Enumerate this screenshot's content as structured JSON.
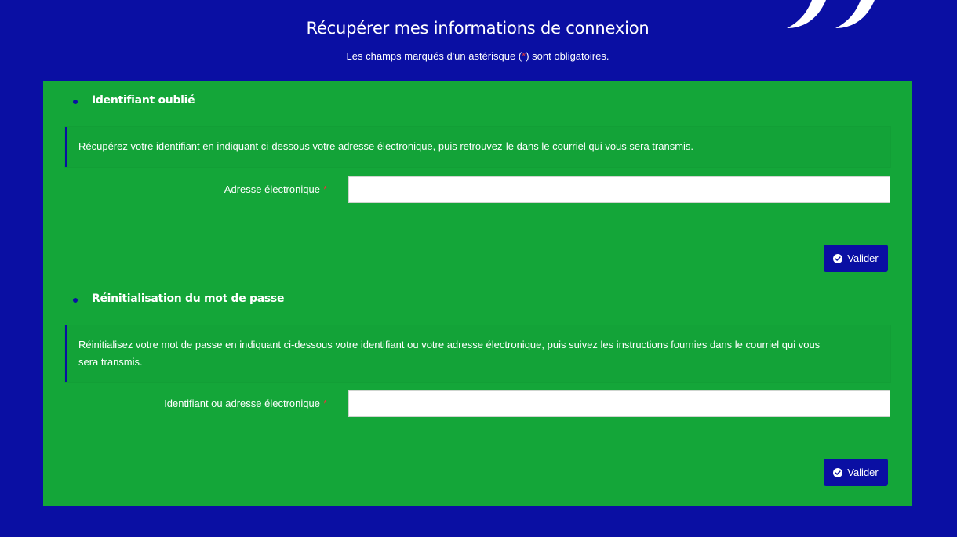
{
  "header": {
    "title": "Récupérer mes informations de connexion",
    "subtitle_prefix": "Les champs marqués d'un astérisque (",
    "subtitle_star": "*",
    "subtitle_suffix": ") sont obligatoires."
  },
  "sections": [
    {
      "heading": "Identifiant oublié",
      "note": "Récupérez votre identifiant en indiquant ci-dessous votre adresse électronique, puis retrouvez-le dans le courriel qui vous sera transmis.",
      "field_label": "Adresse électronique",
      "field_required_marker": "*",
      "field_value": "",
      "button_label": "Valider"
    },
    {
      "heading": "Réinitialisation du mot de passe",
      "note_line1": "Réinitialisez votre mot de passe en indiquant ci-dessous votre identifiant ou votre adresse électronique, puis suivez les instructions fournies dans le courriel qui vous",
      "note_line2": "sera transmis.",
      "field_label": "Identifiant ou adresse électronique",
      "field_required_marker": "*",
      "field_value": "",
      "button_label": "Valider"
    }
  ],
  "colors": {
    "background": "#0a0fa3",
    "panel": "#14a639",
    "button": "#0a0fa3",
    "required": "#e23a3a"
  },
  "icons": {
    "logo": "quote-mark-logo",
    "button": "check-circle-icon"
  }
}
